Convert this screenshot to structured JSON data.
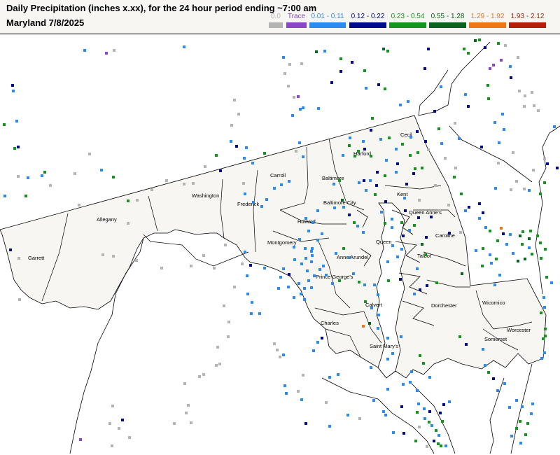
{
  "header": {
    "title": "Daily Precipitation (inches  x.xx),  for the 24 hour period ending ~7:00 am",
    "subtitle": "Maryland 7/8/2025"
  },
  "legend": [
    {
      "label": "0.0",
      "color": "#b4b4b4"
    },
    {
      "label": "Trace",
      "color": "#8c46c8"
    },
    {
      "label": "0.01 - 0.11",
      "color": "#2a8cf0"
    },
    {
      "label": "0.12 - 0.22",
      "color": "#000a8c"
    },
    {
      "label": "0.23 - 0.54",
      "color": "#14961e"
    },
    {
      "label": "0.55 - 1.28",
      "color": "#0a641e"
    },
    {
      "label": "1.29 - 1.92",
      "color": "#f07814"
    },
    {
      "label": "1.93 - 2.12",
      "color": "#b41e0a"
    }
  ],
  "counties": {
    "garrett": "Garrett",
    "allegany": "Allegany",
    "washington": "Washington",
    "frederick": "Frederick",
    "carroll": "Carroll",
    "baltimore": "Baltimore",
    "harford": "Harford",
    "cecil": "Cecil",
    "baltimore_city": "Baltimore City",
    "howard": "Howard",
    "montgomery": "Montgomery",
    "kent": "Kent",
    "queen_annes": "Queen Anne's",
    "anne_arundel": "Anne Arundel",
    "caroline": "Caroline",
    "queen_annes_short": "Queen",
    "talbot": "Talbot",
    "prince_georges": "Prince George's",
    "calvert": "Calvert",
    "dorchester": "Dorchester",
    "wicomico": "Wicomico",
    "charles": "Charles",
    "worcester": "Worcester",
    "somerset": "Somerset",
    "st_marys": "Saint Mary's"
  },
  "colors": {
    "land": "#f7f6f2",
    "water": "#ffffff",
    "border": "#000000"
  }
}
